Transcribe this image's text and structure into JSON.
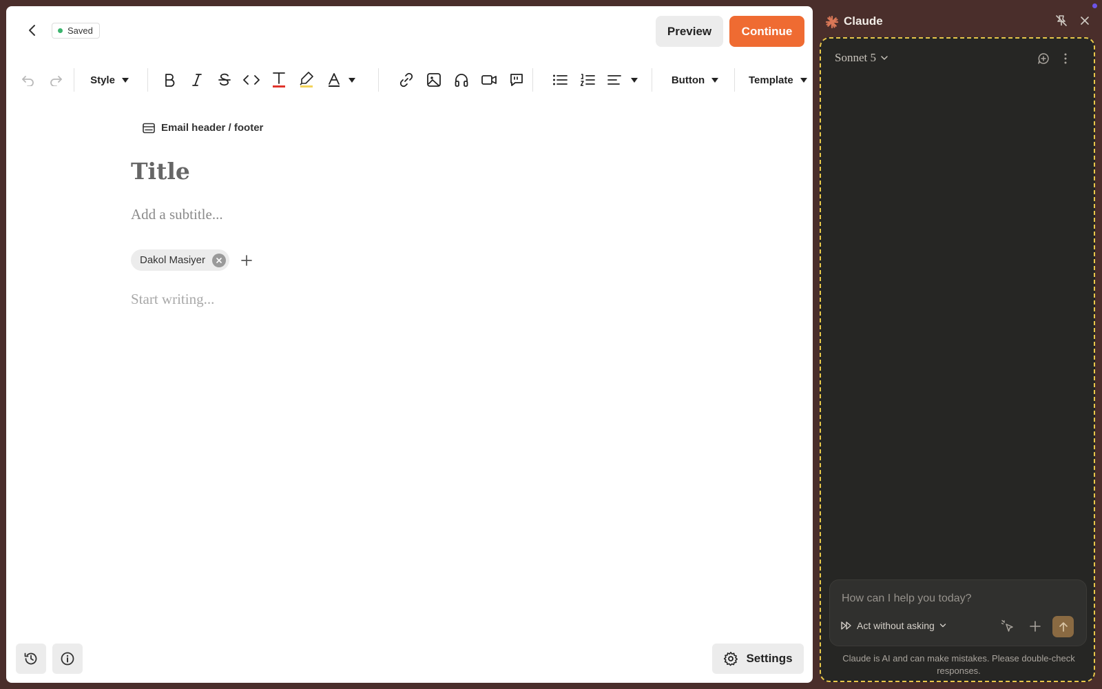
{
  "editor": {
    "status": "Saved",
    "preview_label": "Preview",
    "continue_label": "Continue",
    "toolbar": {
      "style_label": "Style",
      "button_label": "Button",
      "template_label": "Template"
    },
    "email_header_footer": "Email header / footer",
    "title_placeholder": "Title",
    "subtitle_placeholder": "Add a subtitle...",
    "author": "Dakol Masiyer",
    "body_placeholder": "Start writing...",
    "settings_label": "Settings"
  },
  "claude_panel": {
    "title": "Claude",
    "model": "Sonnet 5",
    "input_placeholder": "How can I help you today?",
    "mode": "Act without asking",
    "disclaimer": "Claude is AI and can make mistakes. Please double-check responses."
  },
  "colors": {
    "accent": "#ef6b32",
    "saved_dot": "#3cb46e",
    "text_color_underline": "#e0332b",
    "highlight_underline": "#f3d35a",
    "frame_dash": "#e8c84a",
    "send_button": "#8a6a42"
  },
  "icons": [
    "back-icon",
    "undo-icon",
    "redo-icon",
    "bold-icon",
    "italic-icon",
    "strikethrough-icon",
    "code-icon",
    "text-color-icon",
    "highlight-icon",
    "font-color-icon",
    "link-icon",
    "image-icon",
    "audio-icon",
    "video-icon",
    "quote-icon",
    "bullet-list-icon",
    "numbered-list-icon",
    "align-icon",
    "email-layout-icon",
    "history-icon",
    "info-icon",
    "gear-icon",
    "claude-logo-icon",
    "unpin-icon",
    "close-icon",
    "new-chat-icon",
    "more-icon",
    "chevron-down-icon",
    "fast-forward-icon",
    "pointer-icon",
    "plus-icon",
    "send-arrow-icon"
  ]
}
